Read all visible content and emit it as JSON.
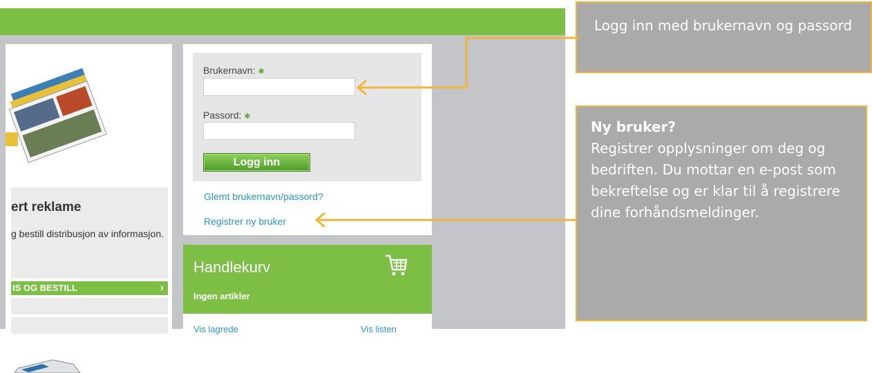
{
  "promo": {
    "title": "ert reklame",
    "text": "g bestill distribusjon av informasjon.",
    "button_label": "IS OG BESTILL",
    "button_chevron": "›"
  },
  "login": {
    "username_label": "Brukernavn:",
    "username_value": "",
    "password_label": "Passord:",
    "password_value": "",
    "required_marker": "✱",
    "submit_label": "Logg inn",
    "forgot_link": "Glemt brukernavn/passord?",
    "register_link": "Registrer ny bruker"
  },
  "cart": {
    "title": "Handlekurv",
    "subtitle": "Ingen artikler",
    "link_left": "Vis lagrede",
    "link_right": "Vis listen",
    "icon": "shopping-cart-icon"
  },
  "callouts": {
    "login_hint": "Logg inn med brukernavn og passord",
    "new_user_title": "Ny bruker?",
    "new_user_text": "Registrer opplysninger om deg og bedriften.  Du mottar en e-post som bekreftelse og er klar til å registrere dine forhåndsmeldinger."
  },
  "colors": {
    "brand_green": "#7dbf45",
    "link_blue": "#2a95c8",
    "callout_border": "#f2b43a",
    "callout_bg": "#aaaaaa"
  }
}
